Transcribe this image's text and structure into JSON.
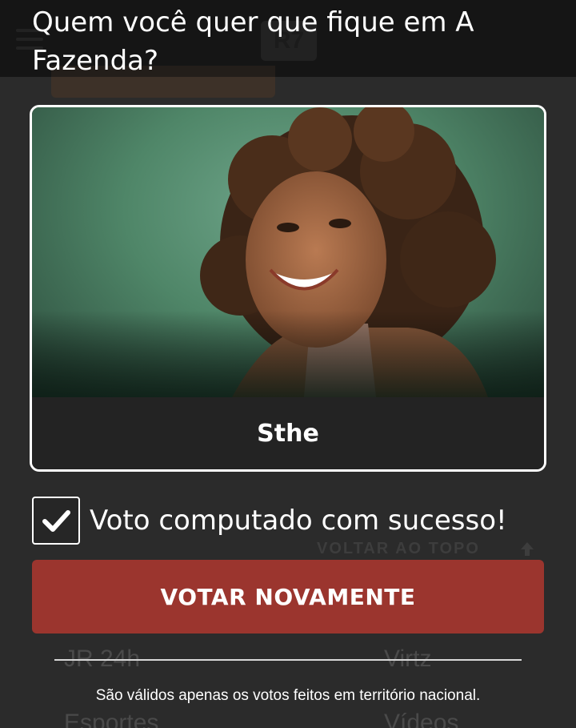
{
  "background": {
    "logo_text": "R7",
    "links": {
      "jr24h": "JR 24h",
      "virtz": "Virtz",
      "esportes": "Esportes",
      "videos": "Vídeos"
    },
    "back_to_top": "VOLTAR AO TOPO"
  },
  "modal": {
    "title": "Quem você quer que fique em A Fazenda?",
    "candidate": {
      "name": "Sthe"
    },
    "vote_status": "Voto computado com sucesso!",
    "vote_again_label": "VOTAR NOVAMENTE",
    "disclaimer": "São válidos apenas os votos feitos em território nacional."
  },
  "colors": {
    "accent_button": "#9b352e",
    "background": "#2b2b2b",
    "card_border": "#ffffff"
  },
  "icons": [
    "menu-icon",
    "check-icon",
    "arrow-up-icon"
  ]
}
